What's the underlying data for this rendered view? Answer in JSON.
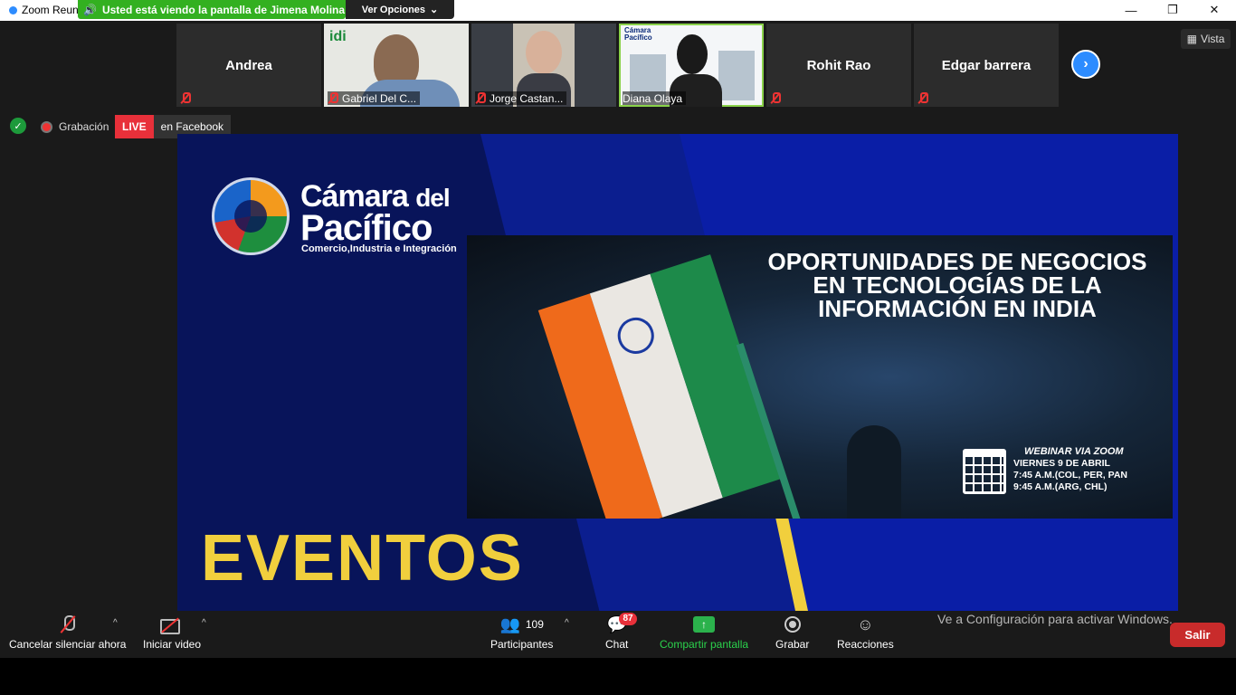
{
  "window": {
    "title": "Zoom Reun",
    "minimize": "—",
    "restore": "❐",
    "close": "✕"
  },
  "share_banner": {
    "text": "Usted está viendo la pantalla de Jimena Molina",
    "view_options": "Ver Opciones"
  },
  "participants_strip": [
    {
      "name": "Andrea",
      "label": ""
    },
    {
      "name": "",
      "label": "Gabriel Del C..."
    },
    {
      "name": "",
      "label": "Jorge Castan..."
    },
    {
      "name": "",
      "label": "Diana Olaya"
    },
    {
      "name": "Rohit Rao",
      "label": ""
    },
    {
      "name": "Edgar barrera",
      "label": ""
    }
  ],
  "vista_label": "Vista",
  "status": {
    "recording": "Grabación",
    "live": "LIVE",
    "live_platform": "en Facebook"
  },
  "slide": {
    "brand_line1": "Cámara",
    "brand_line1b": "del",
    "brand_line2": "Pacífico",
    "brand_line3": "Comercio,Industria e Integración",
    "poster_title": "OPORTUNIDADES DE NEGOCIOS EN TECNOLOGÍAS DE LA INFORMACIÓN EN INDIA",
    "webinar_line1": "WEBINAR VIA ZOOM",
    "webinar_line2": "VIERNES 9 DE ABRIL",
    "webinar_line3": "7:45  A.M.(COL, PER, PAN",
    "webinar_line4": "9:45  A.M.(ARG, CHL)",
    "footer": "EVENTOS"
  },
  "toolbar": {
    "unmute": "Cancelar silenciar ahora",
    "start_video": "Iniciar video",
    "participants": "Participantes",
    "participants_count": "109",
    "chat": "Chat",
    "chat_badge": "87",
    "share": "Compartir pantalla",
    "record": "Grabar",
    "reactions": "Reacciones",
    "leave": "Salir"
  },
  "watermark": "Ve a Configuración para activar Windows."
}
